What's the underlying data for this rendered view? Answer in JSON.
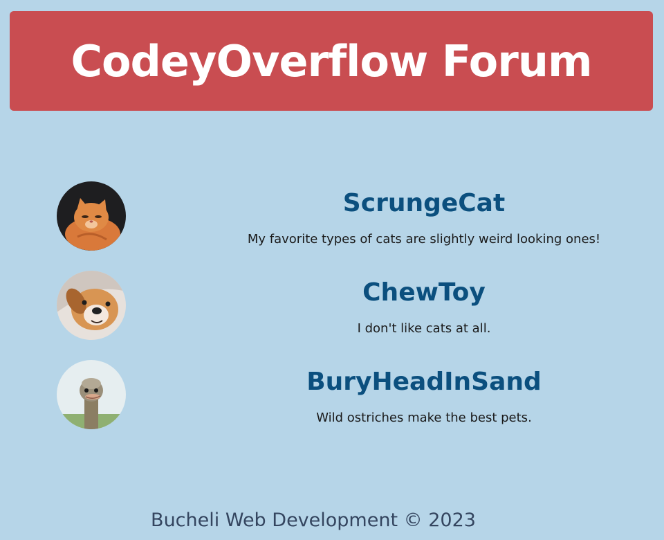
{
  "header": {
    "title": "CodeyOverflow Forum"
  },
  "posts": [
    {
      "username": "ScrungeCat",
      "message": "My favorite types of cats are slightly weird looking ones!",
      "avatar_icon": "orange-cat-photo"
    },
    {
      "username": "ChewToy",
      "message": "I don't like cats at all.",
      "avatar_icon": "dog-photo"
    },
    {
      "username": "BuryHeadInSand",
      "message": "Wild ostriches make the best pets.",
      "avatar_icon": "ostrich-photo"
    }
  ],
  "footer": {
    "text": "Bucheli Web Development © 2023"
  },
  "colors": {
    "background": "#b6d5e8",
    "header": "#c94d51",
    "username": "#0b4f7e",
    "footer_text": "#34455f"
  }
}
